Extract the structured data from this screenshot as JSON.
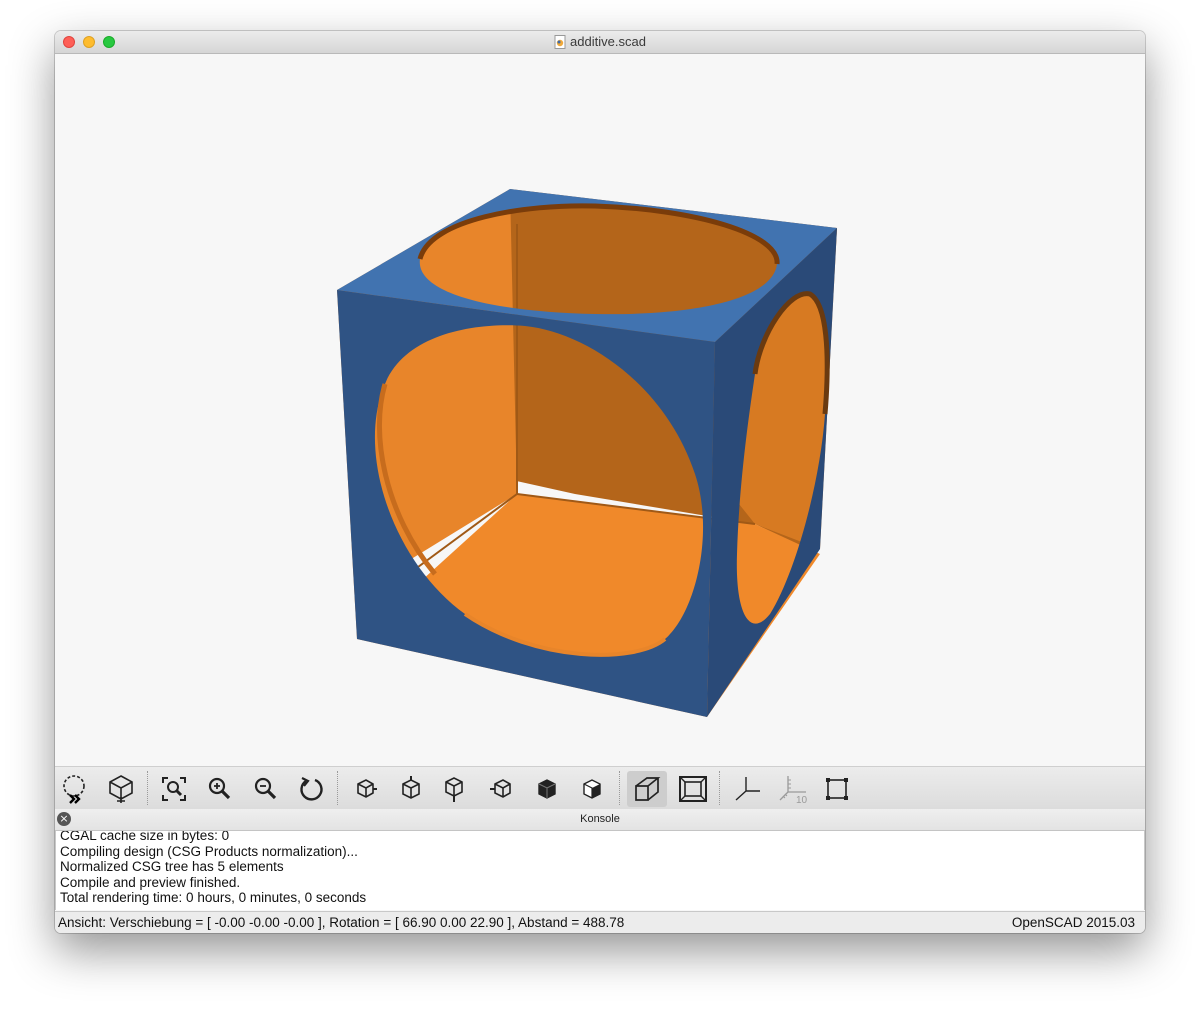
{
  "window": {
    "title": "additive.scad",
    "icons": [
      "close-window",
      "minimize-window",
      "zoom-window",
      "scad-document-icon"
    ]
  },
  "viewport": {
    "model": "additive.scad preview",
    "colors": {
      "background": "#f7f7f7",
      "outer": "#3e6aa7",
      "inner": "#f0892a"
    }
  },
  "toolbar": {
    "buttons": [
      {
        "id": "preview",
        "icon": "preview-icon"
      },
      {
        "id": "render",
        "icon": "render-icon"
      },
      {
        "id": "view-all",
        "icon": "view-all-icon"
      },
      {
        "id": "zoom-in",
        "icon": "zoom-in-icon"
      },
      {
        "id": "zoom-out",
        "icon": "zoom-out-icon"
      },
      {
        "id": "reset-view",
        "icon": "reset-view-icon"
      },
      {
        "id": "view-right",
        "icon": "view-right-icon"
      },
      {
        "id": "view-top",
        "icon": "view-top-icon"
      },
      {
        "id": "view-bottom",
        "icon": "view-bottom-icon"
      },
      {
        "id": "view-left",
        "icon": "view-left-icon"
      },
      {
        "id": "view-front",
        "icon": "view-front-icon"
      },
      {
        "id": "view-back",
        "icon": "view-back-icon"
      },
      {
        "id": "perspective",
        "icon": "perspective-icon",
        "active": true
      },
      {
        "id": "orthogonal",
        "icon": "orthogonal-icon"
      },
      {
        "id": "show-axes",
        "icon": "show-axes-icon"
      },
      {
        "id": "show-scale-markers",
        "icon": "scale-markers-icon",
        "disabled": true
      },
      {
        "id": "show-edges",
        "icon": "show-edges-icon"
      }
    ],
    "scale_marker_text": "10"
  },
  "console": {
    "title": "Konsole",
    "lines": [
      "CGAL cache size in bytes: 0",
      "Compiling design (CSG Products normalization)...",
      "Normalized CSG tree has 5 elements",
      "Compile and preview finished.",
      "Total rendering time: 0 hours, 0 minutes, 0 seconds"
    ]
  },
  "statusbar": {
    "view_info": "Ansicht: Verschiebung = [ -0.00 -0.00 -0.00 ], Rotation = [ 66.90 0.00 22.90 ], Abstand = 488.78",
    "version": "OpenSCAD 2015.03"
  }
}
